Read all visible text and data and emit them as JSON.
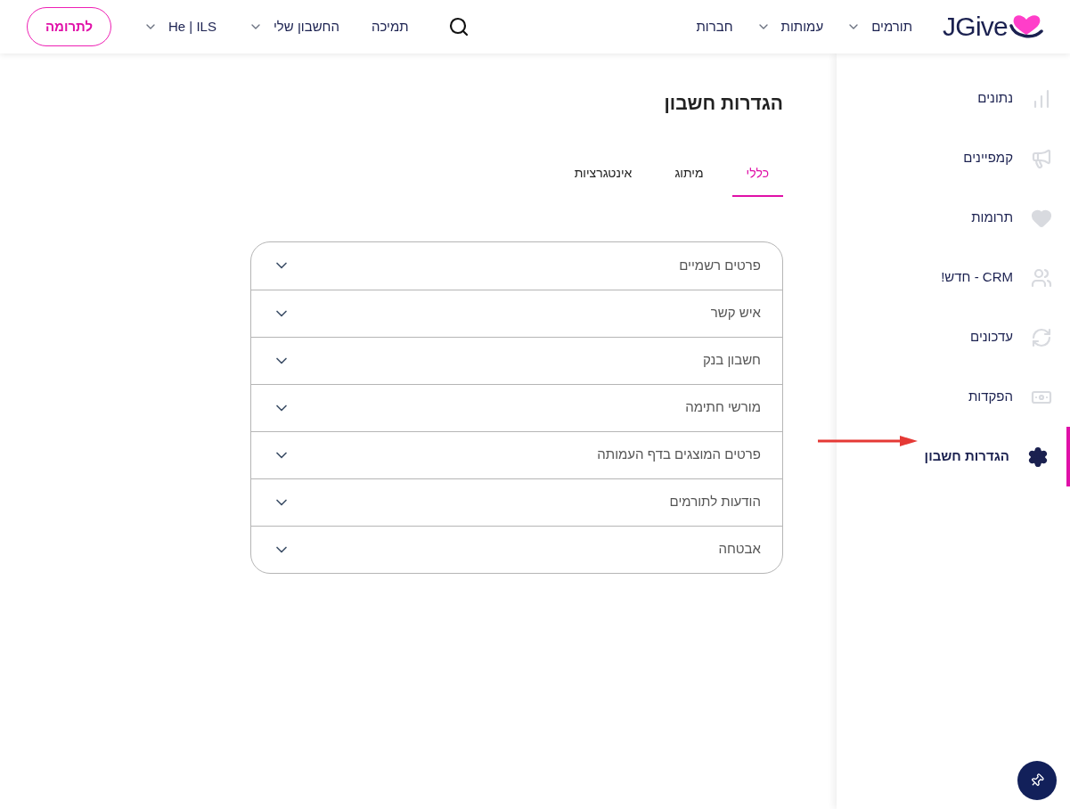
{
  "header": {
    "logo": "JGive",
    "nav": [
      {
        "label": "תורמים",
        "dropdown": true
      },
      {
        "label": "עמותות",
        "dropdown": true
      },
      {
        "label": "חברות",
        "dropdown": false
      }
    ],
    "utility": [
      {
        "label": "תמיכה",
        "dropdown": false
      },
      {
        "label": "החשבון שלי",
        "dropdown": true
      },
      {
        "label": "He | ILS",
        "dropdown": true
      }
    ],
    "donate_button": "לתרומה"
  },
  "sidebar": {
    "items": [
      {
        "label": "נתונים",
        "selected": false
      },
      {
        "label": "קמפיינים",
        "selected": false
      },
      {
        "label": "תרומות",
        "selected": false
      },
      {
        "label": "CRM - חדש!",
        "selected": false
      },
      {
        "label": "עדכונים",
        "selected": false
      },
      {
        "label": "הפקדות",
        "selected": false
      },
      {
        "label": "הגדרות חשבון",
        "selected": true
      }
    ]
  },
  "page": {
    "title": "הגדרות חשבון",
    "tabs": [
      {
        "label": "כללי",
        "selected": true
      },
      {
        "label": "מיתוג",
        "selected": false
      },
      {
        "label": "אינטגרציות",
        "selected": false
      }
    ],
    "sections": [
      {
        "label": "פרטים רשמיים",
        "expanded": false
      },
      {
        "label": "איש קשר",
        "expanded": false
      },
      {
        "label": "חשבון בנק",
        "expanded": false
      },
      {
        "label": "מורשי חתימה",
        "expanded": false
      },
      {
        "label": "פרטים המוצגים בדף העמותה",
        "expanded": false
      },
      {
        "label": "הודעות לתורמים",
        "expanded": false
      },
      {
        "label": "אבטחה",
        "expanded": false
      }
    ]
  }
}
